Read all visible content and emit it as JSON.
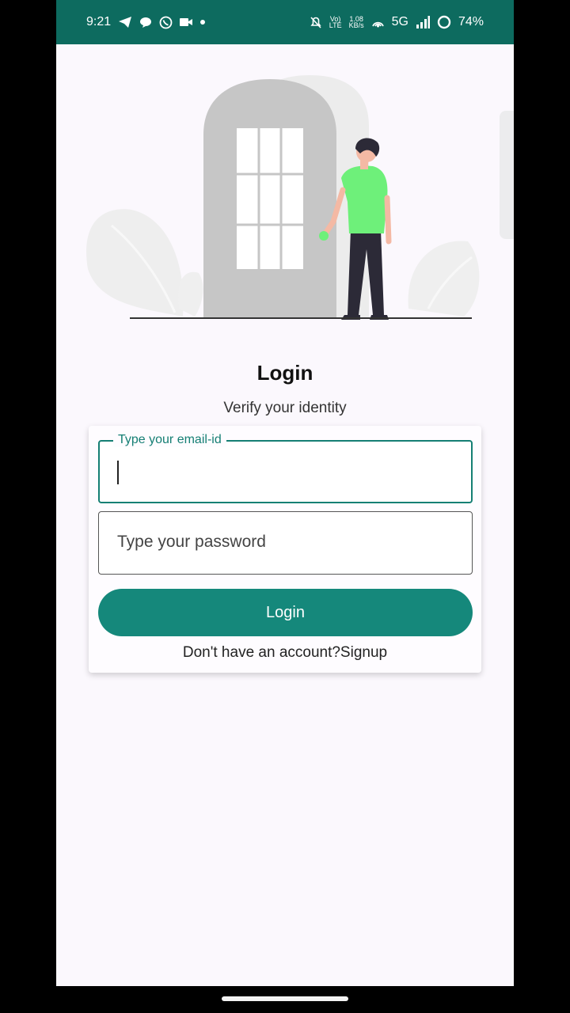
{
  "status_bar": {
    "time": "9:21",
    "battery_percent": "74%",
    "network": "5G",
    "net_speed_top": "1.08",
    "net_speed_bottom": "KB/s",
    "volte_top": "Vo)",
    "volte_bottom": "LTE",
    "left_icons": [
      "telegram-icon",
      "chat-icon",
      "whatsapp-icon",
      "video-icon",
      "dot-icon"
    ],
    "right_icons": [
      "mute-icon",
      "hotspot-icon",
      "signal-icon",
      "battery-icon"
    ]
  },
  "login": {
    "title": "Login",
    "subtitle": "Verify your identity",
    "email_label": "Type your email-id",
    "email_value": "",
    "password_placeholder": "Type your password",
    "button_label": "Login",
    "signup_text": "Don't have an account?Signup"
  },
  "colors": {
    "status_bar": "#0d6b5f",
    "accent": "#15887b",
    "background": "#fbf8fd",
    "shirt": "#6ef07a"
  }
}
